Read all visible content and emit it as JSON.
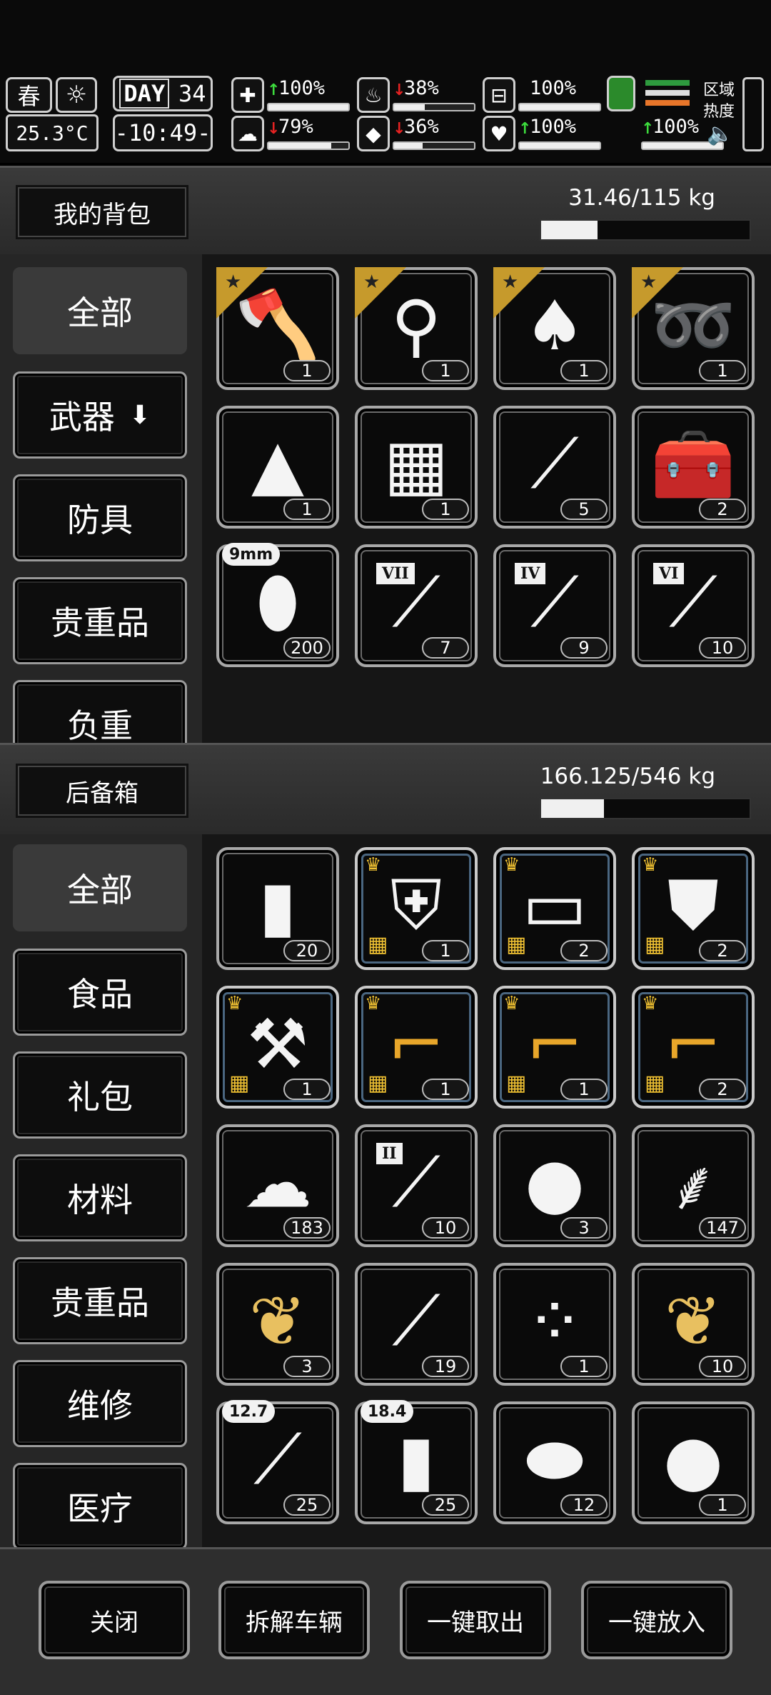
{
  "status": {
    "season": "春",
    "temperature": "25.3°C",
    "day_label": "DAY",
    "day_number": "34",
    "time": "-10:49-",
    "stats": [
      {
        "icon": "medkit-icon",
        "glyph": "✚",
        "trend": "up",
        "arrow": "↑",
        "value": "100%",
        "level": 1.0
      },
      {
        "icon": "stomach-icon",
        "glyph": "♨",
        "trend": "down",
        "arrow": "↓",
        "value": "38%",
        "level": 0.38
      },
      {
        "icon": "bladder-icon",
        "glyph": "⊟",
        "trend": "none",
        "arrow": "",
        "value": "100%",
        "level": 1.0
      },
      {
        "icon": "brain-icon",
        "glyph": "☁",
        "trend": "down",
        "arrow": "↓",
        "value": "79%",
        "level": 0.79
      },
      {
        "icon": "water-drop-icon",
        "glyph": "◆",
        "trend": "down",
        "arrow": "↓",
        "value": "36%",
        "level": 0.36
      },
      {
        "icon": "heart-icon",
        "glyph": "♥",
        "trend": "up",
        "arrow": "↑",
        "value": "100%",
        "level": 1.0
      },
      {
        "icon": "stamina-icon",
        "glyph": "",
        "trend": "up",
        "arrow": "↑",
        "value": "100%",
        "level": 1.0
      }
    ],
    "region_line1": "区域",
    "region_line2": "热度",
    "tri_colors": [
      "#2e9a3e",
      "#dedede",
      "#e8762a"
    ]
  },
  "backpack": {
    "title": "我的背包",
    "weight": "31.46/115 kg",
    "weight_fraction": 0.27,
    "categories": [
      "全部",
      "武器",
      "防具",
      "贵重品",
      "负重"
    ],
    "active_category": "全部",
    "weapon_arrow": "⬇",
    "items": [
      {
        "name": "axe-icon",
        "glyph": "🪓",
        "qty": "1",
        "star": true
      },
      {
        "name": "shovel-icon",
        "glyph": "⚲",
        "qty": "1",
        "star": true
      },
      {
        "name": "spade-icon",
        "glyph": "♠",
        "qty": "1",
        "star": true
      },
      {
        "name": "whip-icon",
        "glyph": "➿",
        "qty": "1",
        "star": true
      },
      {
        "name": "cloth-rag-icon",
        "glyph": "▲",
        "qty": "1"
      },
      {
        "name": "towel-icon",
        "glyph": "▦",
        "qty": "1"
      },
      {
        "name": "tweezers-icon",
        "glyph": "⟋",
        "qty": "5"
      },
      {
        "name": "toolbox-icon",
        "glyph": "🧰",
        "qty": "2"
      },
      {
        "name": "bullet-icon",
        "glyph": "⬮",
        "qty": "200",
        "tag": "9mm"
      },
      {
        "name": "test-tube-icon",
        "glyph": "⟋",
        "qty": "7",
        "roman": "VII"
      },
      {
        "name": "test-tube-icon",
        "glyph": "⟋",
        "qty": "9",
        "roman": "IV"
      },
      {
        "name": "test-tube-icon",
        "glyph": "⟋",
        "qty": "10",
        "roman": "VI"
      }
    ]
  },
  "trunk": {
    "title": "后备箱",
    "weight": "166.125/546 kg",
    "weight_fraction": 0.3,
    "categories": [
      "全部",
      "食品",
      "礼包",
      "材料",
      "贵重品",
      "维修",
      "医疗"
    ],
    "active_category": "全部",
    "items": [
      {
        "name": "water-bottle-icon",
        "glyph": "▮",
        "qty": "20"
      },
      {
        "name": "armor-suit-icon",
        "glyph": "⛨",
        "qty": "1",
        "gift": true
      },
      {
        "name": "armor-plate-icon",
        "glyph": "▭",
        "qty": "2",
        "gift": true
      },
      {
        "name": "tactical-vest-icon",
        "glyph": "⛊",
        "qty": "2",
        "gift": true
      },
      {
        "name": "rifle-parts-icon",
        "glyph": "⚒",
        "qty": "1",
        "gift": true
      },
      {
        "name": "assault-rifle-icon",
        "glyph": "⌐",
        "qty": "1",
        "gift": true,
        "color": "gold"
      },
      {
        "name": "weapon-blueprint-icon",
        "glyph": "⌐",
        "qty": "1",
        "gift": true,
        "color": "gold"
      },
      {
        "name": "pistol-icon",
        "glyph": "⌐",
        "qty": "2",
        "gift": true,
        "color": "gold"
      },
      {
        "name": "cloth-bundle-icon",
        "glyph": "☁",
        "qty": "183"
      },
      {
        "name": "test-tube-icon",
        "glyph": "⟋",
        "qty": "10",
        "roman": "II"
      },
      {
        "name": "tool-bag-icon",
        "glyph": "●",
        "qty": "3"
      },
      {
        "name": "wheat-icon",
        "glyph": "⸙",
        "qty": "147"
      },
      {
        "name": "tobacco-leaf-icon",
        "glyph": "❦",
        "qty": "3",
        "color": "yellow"
      },
      {
        "name": "syringe-tool-icon",
        "glyph": "⟋",
        "qty": "19"
      },
      {
        "name": "pills-icon",
        "glyph": "⁘",
        "qty": "1"
      },
      {
        "name": "tobacco-leaf-icon",
        "glyph": "❦",
        "qty": "10",
        "color": "yellow"
      },
      {
        "name": "rifle-bullet-icon",
        "glyph": "⟋",
        "qty": "25",
        "tag": "12.7"
      },
      {
        "name": "shotgun-shell-icon",
        "glyph": "▮",
        "qty": "25",
        "tag": "18.4"
      },
      {
        "name": "meat-icon",
        "glyph": "⬬",
        "qty": "12"
      },
      {
        "name": "sprouting-seed-icon",
        "glyph": "●",
        "qty": "1"
      }
    ]
  },
  "footer": {
    "buttons": [
      "关闭",
      "拆解车辆",
      "一键取出",
      "一键放入"
    ]
  }
}
